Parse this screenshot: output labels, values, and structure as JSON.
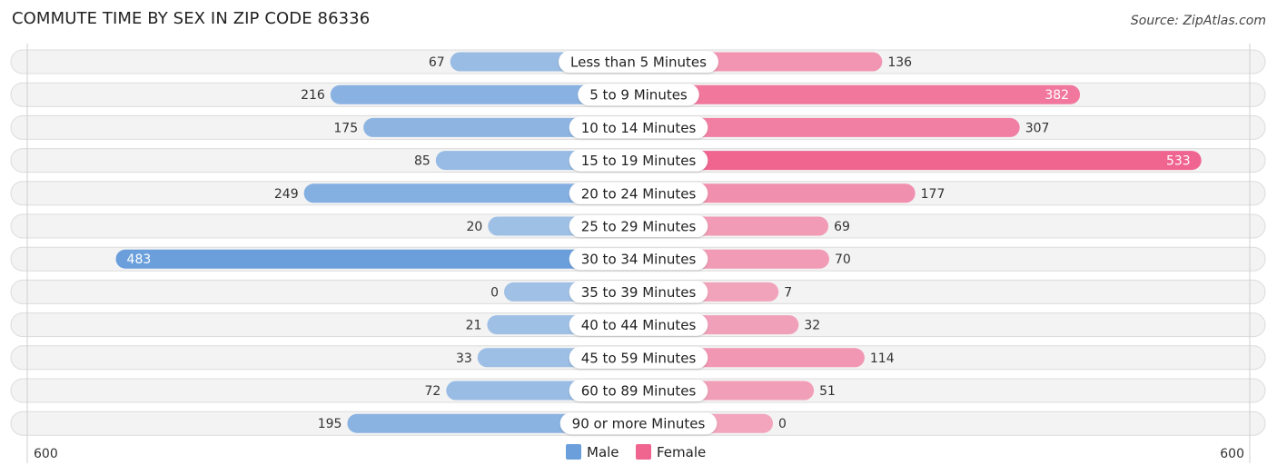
{
  "chart_data": {
    "type": "bar",
    "orientation": "horizontal-diverging",
    "title": "COMMUTE TIME BY SEX IN ZIP CODE 86336",
    "source": "Source: ZipAtlas.com",
    "categories": [
      "Less than 5 Minutes",
      "5 to 9 Minutes",
      "10 to 14 Minutes",
      "15 to 19 Minutes",
      "20 to 24 Minutes",
      "25 to 29 Minutes",
      "30 to 34 Minutes",
      "35 to 39 Minutes",
      "40 to 44 Minutes",
      "45 to 59 Minutes",
      "60 to 89 Minutes",
      "90 or more Minutes"
    ],
    "series": [
      {
        "name": "Male",
        "color": "#6a9fdc",
        "values": [
          67,
          216,
          175,
          85,
          249,
          20,
          483,
          0,
          21,
          33,
          72,
          195
        ]
      },
      {
        "name": "Female",
        "color": "#f06490",
        "values": [
          136,
          382,
          307,
          533,
          177,
          69,
          70,
          7,
          32,
          114,
          51,
          0
        ]
      }
    ],
    "axis": {
      "left_label": "600",
      "right_label": "600",
      "max": 600
    },
    "legend": {
      "position": "bottom-center",
      "items": [
        "Male",
        "Female"
      ]
    },
    "xlabel": "",
    "ylabel": ""
  }
}
